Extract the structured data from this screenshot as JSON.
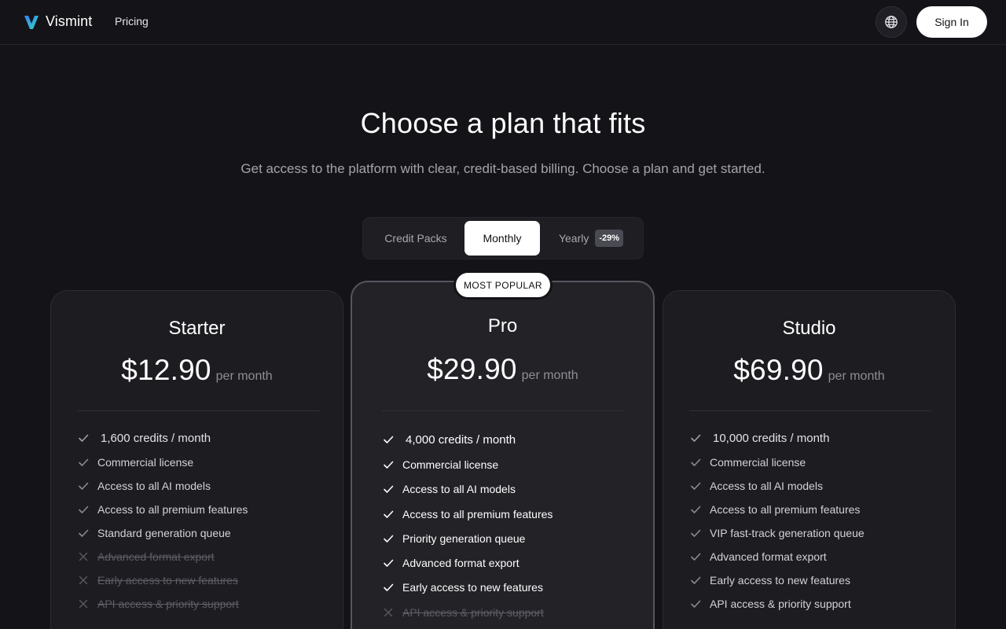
{
  "header": {
    "logo_text": "Vismint",
    "nav_pricing": "Pricing",
    "globe_icon": "globe-icon",
    "sign_in_label": "Sign In"
  },
  "hero": {
    "title": "Choose a plan that fits",
    "subtitle": "Get access to the platform with clear, credit-based billing. Choose a plan and get started."
  },
  "toggle": {
    "credit_packs": "Credit Packs",
    "monthly": "Monthly",
    "yearly": "Yearly",
    "yearly_badge": "-29%",
    "selected": "Monthly"
  },
  "popular_label": "MOST POPULAR",
  "colors": {
    "background": "#141418",
    "card": "#1c1c21",
    "accent_white": "#ffffff",
    "logo_gradient_start": "#3b82f6",
    "logo_gradient_end": "#2dd4bf"
  },
  "plans": [
    {
      "name": "Starter",
      "price": "$12.90",
      "period": "per month",
      "features": [
        {
          "text": "1,600 credits / month",
          "included": true,
          "highlight": true
        },
        {
          "text": "Commercial license",
          "included": true
        },
        {
          "text": "Access to all AI models",
          "included": true
        },
        {
          "text": "Access to all premium features",
          "included": true
        },
        {
          "text": "Standard generation queue",
          "included": true
        },
        {
          "text": "Advanced format export",
          "included": false
        },
        {
          "text": "Early access to new features",
          "included": false
        },
        {
          "text": "API access & priority support",
          "included": false
        }
      ]
    },
    {
      "name": "Pro",
      "price": "$29.90",
      "period": "per month",
      "features": [
        {
          "text": "4,000 credits / month",
          "included": true,
          "highlight": true
        },
        {
          "text": "Commercial license",
          "included": true
        },
        {
          "text": "Access to all AI models",
          "included": true
        },
        {
          "text": "Access to all premium features",
          "included": true
        },
        {
          "text": "Priority generation queue",
          "included": true
        },
        {
          "text": "Advanced format export",
          "included": true
        },
        {
          "text": "Early access to new features",
          "included": true
        },
        {
          "text": "API access & priority support",
          "included": false
        }
      ]
    },
    {
      "name": "Studio",
      "price": "$69.90",
      "period": "per month",
      "features": [
        {
          "text": "10,000 credits / month",
          "included": true,
          "highlight": true
        },
        {
          "text": "Commercial license",
          "included": true
        },
        {
          "text": "Access to all AI models",
          "included": true
        },
        {
          "text": "Access to all premium features",
          "included": true
        },
        {
          "text": "VIP fast-track generation queue",
          "included": true
        },
        {
          "text": "Advanced format export",
          "included": true
        },
        {
          "text": "Early access to new features",
          "included": true
        },
        {
          "text": "API access & priority support",
          "included": true
        }
      ]
    }
  ]
}
